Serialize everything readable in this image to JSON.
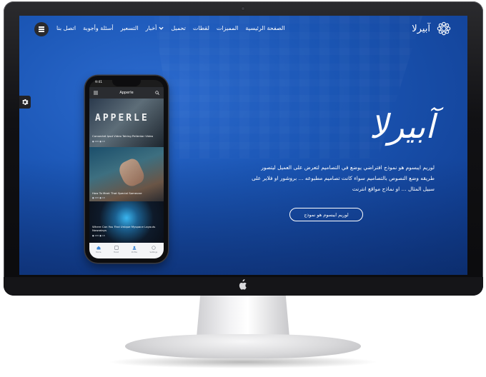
{
  "nav": {
    "brand": "آبيرلا",
    "items": [
      {
        "label": "الصفحة الرئيسية"
      },
      {
        "label": "المميزات"
      },
      {
        "label": "لقطات"
      },
      {
        "label": "تحميل"
      },
      {
        "label": "أخبار",
        "has_dropdown": true
      },
      {
        "label": "التسعير"
      },
      {
        "label": "أسئلة وأجوبة"
      },
      {
        "label": "اتصل بنا"
      }
    ]
  },
  "hero": {
    "title": "آبيرلا",
    "text": "لوريم ايبسوم هو نموذج افتراضي يوضع في التصاميم لتعرض على العميل ليتصور طريقه وضع النصوص بالتصاميم سواء كانت تصاميم مطبوعه ... بروشور او فلاير على سبيل المثال ... او نماذج مواقع انترنت",
    "button_label": "لوريم ايبسوم هو نموذج"
  },
  "phone": {
    "status_time": "9:41",
    "app_title": "Apperle",
    "cards": [
      {
        "banner": "APPERLE",
        "caption": "Consectet Ipsd Video Taking Pellentar Video",
        "meta": "● 295  ● 18"
      },
      {
        "banner": "",
        "caption": "How To Meet That Special Someone",
        "meta": "● 295  ● 18"
      },
      {
        "banner": "",
        "caption": "Where Can You Find Unique Myspace Layouts Nowadays",
        "meta": "● 295  ● 18"
      }
    ],
    "tabs": [
      {
        "label": "Home",
        "icon": "home-icon"
      },
      {
        "label": "Trend",
        "icon": "trend-icon"
      },
      {
        "label": "Profile",
        "icon": "profile-icon"
      },
      {
        "label": "Settings",
        "icon": "settings-icon"
      }
    ]
  },
  "colors": {
    "screen_blue": "#1b56b5",
    "bezel": "#111114",
    "text": "#ffffff"
  }
}
